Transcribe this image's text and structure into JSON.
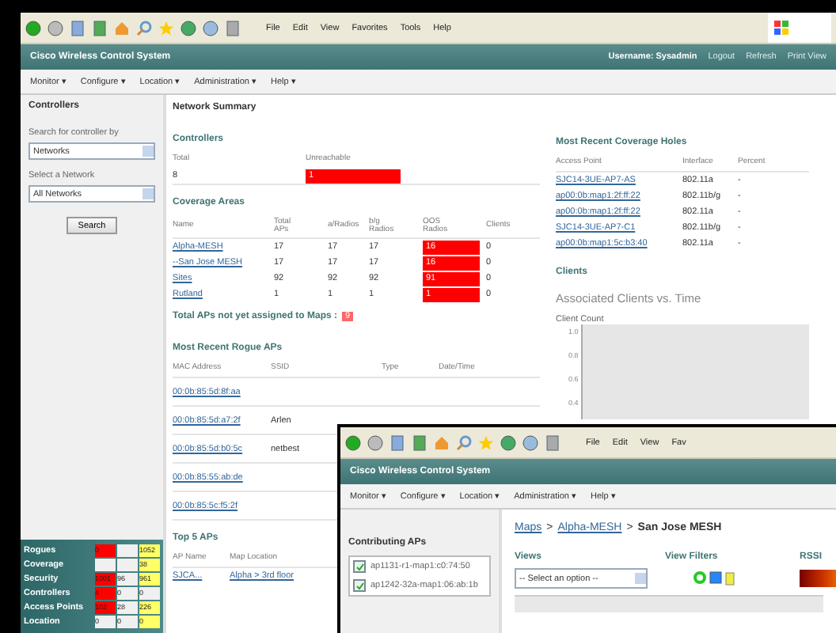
{
  "back_window": {
    "browser_menu": [
      "File",
      "Edit",
      "View",
      "Favorites",
      "Tools",
      "Help"
    ],
    "app_title": "Cisco Wireless Control System",
    "header_links": [
      {
        "label": "Username: Sysadmin",
        "kind": "text"
      },
      {
        "label": "Logout",
        "kind": "link"
      },
      {
        "label": "Refresh",
        "kind": "link"
      },
      {
        "label": "Print View",
        "kind": "link"
      }
    ],
    "nav_menu": [
      "Monitor ▾",
      "Configure ▾",
      "Location ▾",
      "Administration ▾",
      "Help ▾"
    ],
    "sidebar": {
      "title": "Controllers",
      "search_by_label": "Search for controller by",
      "search_by_value": "Networks",
      "network_label": "Select a Network",
      "network_value": "All Networks",
      "button": "Search"
    },
    "alarm_summary": [
      {
        "label": "Rogues",
        "cells": [
          {
            "value": "0",
            "color": "#ff0000"
          },
          {
            "color": "#f0f0f0"
          },
          {
            "value": "1052",
            "color": "#ffff66"
          }
        ]
      },
      {
        "label": "Coverage",
        "cells": [
          {
            "color": "#f0f0f0"
          },
          {
            "color": "#f0f0f0"
          },
          {
            "value": "38",
            "color": "#ffff66"
          }
        ]
      },
      {
        "label": "Security",
        "cells": [
          {
            "value": "1001",
            "color": "#ff0000"
          },
          {
            "value": "96",
            "color": "#f0f0f0"
          },
          {
            "value": "961",
            "color": "#ffff66"
          }
        ]
      },
      {
        "label": "Controllers",
        "cells": [
          {
            "value": "4",
            "color": "#ff0000"
          },
          {
            "value": "0",
            "color": "#f0f0f0"
          },
          {
            "value": "0",
            "color": "#f0f0f0"
          }
        ]
      },
      {
        "label": "Access Points",
        "cells": [
          {
            "value": "102",
            "color": "#ff0000"
          },
          {
            "value": "28",
            "color": "#f0f0f0"
          },
          {
            "value": "226",
            "color": "#ffff66"
          }
        ]
      },
      {
        "label": "Location",
        "cells": [
          {
            "value": "0",
            "color": "#f0f0f0"
          },
          {
            "value": "0",
            "color": "#f0f0f0"
          },
          {
            "value": "0",
            "color": "#ffff66"
          }
        ]
      }
    ],
    "page_title": "Network Summary",
    "controllers": {
      "title": "Controllers",
      "columns": [
        "Total",
        "Unreachable"
      ],
      "total": "8",
      "unreachable": "1",
      "unreachable_alert": true
    },
    "coverage_areas": {
      "title": "Coverage Areas",
      "columns": [
        "Name",
        "Total APs",
        "a/Radios",
        "b/g Radios",
        "OOS Radios",
        "Clients"
      ],
      "rows": [
        {
          "cells": [
            "Alpha-MESH",
            "17",
            "17",
            "17",
            "16",
            "0"
          ],
          "oos_alert": true
        },
        {
          "cells": [
            "--San Jose MESH",
            "17",
            "17",
            "17",
            "16",
            "0"
          ],
          "oos_alert": true
        },
        {
          "cells": [
            "Sites",
            "92",
            "92",
            "92",
            "91",
            "0"
          ],
          "oos_alert": true
        },
        {
          "cells": [
            "Rutland",
            "1",
            "1",
            "1",
            "1",
            "0"
          ],
          "oos_alert": true
        }
      ]
    },
    "unassigned": {
      "label": "Total APs not yet assigned to Maps :",
      "value": "9"
    },
    "rogue_aps": {
      "title": "Most Recent Rogue APs",
      "columns": [
        "MAC Address",
        "SSID",
        "Type",
        "Date/Time"
      ],
      "rows": [
        {
          "mac": "00:0b:85:5d:8f:aa"
        },
        {
          "mac": "00:0b:85:5d:a7:2f",
          "ssid": "Arlen"
        },
        {
          "mac": "00:0b:85:5d:b0:5c",
          "ssid": "netbest"
        },
        {
          "mac": "00:0b:85:55:ab:de"
        },
        {
          "mac": "00:0b:85:5c:f5:2f"
        }
      ]
    },
    "top_aps": {
      "title": "Top 5 APs",
      "columns": [
        "AP Name",
        "Map Location"
      ],
      "rows": [
        {
          "name": "SJCA...",
          "location": "Alpha > 3rd floor"
        }
      ]
    },
    "coverage_holes": {
      "title": "Most Recent Coverage Holes",
      "columns": [
        "Access Point",
        "Interface",
        "Percent"
      ],
      "rows": [
        {
          "ap": "SJC14-3UE-AP7-AS",
          "interface": "802.11a",
          "percent": "-"
        },
        {
          "ap": "ap00:0b:map1:2f:ff:22",
          "interface": "802.11b/g",
          "percent": "-"
        },
        {
          "ap": "ap00:0b:map1:2f:ff:22",
          "interface": "802.11a",
          "percent": "-"
        },
        {
          "ap": "SJC14-3UE-AP7-C1",
          "interface": "802.11b/g",
          "percent": "-"
        },
        {
          "ap": "ap00:0b:map1:5c:b3:40",
          "interface": "802.11a",
          "percent": "-"
        }
      ]
    },
    "clients": {
      "title": "Clients",
      "chart_title": "Associated Clients vs. Time",
      "ylabel": "Client Count",
      "yticks": [
        "1.0",
        "0.8",
        "0.6",
        "0.4"
      ]
    }
  },
  "front_window": {
    "browser_menu": [
      "File",
      "Edit",
      "View",
      "Fav"
    ],
    "app_title": "Cisco Wireless Control System",
    "nav_menu": [
      "Monitor ▾",
      "Configure ▾",
      "Location ▾",
      "Administration ▾",
      "Help ▾"
    ],
    "sidebar_title": "Contributing APs",
    "ap_list": [
      {
        "label": "ap1131-r1-map1:c0:74:50",
        "checked": true
      },
      {
        "label": "ap1242-32a-map1:06:ab:1b",
        "checked": true
      }
    ],
    "breadcrumb": [
      {
        "label": "Maps",
        "kind": "link"
      },
      {
        "label": ">",
        "kind": "separator"
      },
      {
        "label": "Alpha-MESH",
        "kind": "link"
      },
      {
        "label": ">",
        "kind": "separator"
      },
      {
        "label": "San Jose MESH",
        "kind": "text"
      }
    ],
    "views_label": "Views",
    "view_filters_label": "View Filters",
    "rssi_label": "RSSI",
    "views_select": "-- Select an option --"
  }
}
